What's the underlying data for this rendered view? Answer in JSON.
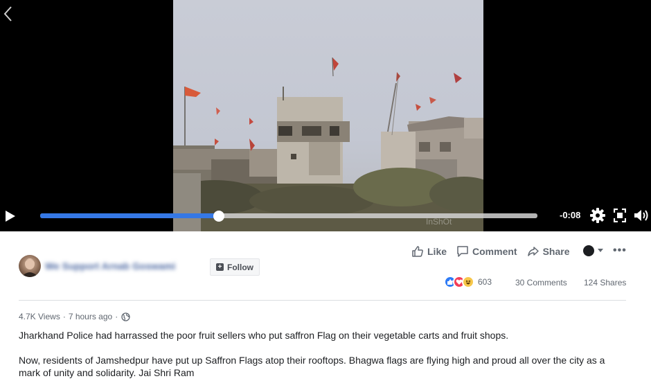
{
  "video": {
    "time_remaining": "-0:08",
    "progress": 0.36,
    "watermark": "InShOt"
  },
  "post": {
    "page_name": "We Support Arnab Goswami",
    "follow_label": "Follow",
    "actions": {
      "like": "Like",
      "comment": "Comment",
      "share": "Share"
    },
    "stats": {
      "reactions": "603",
      "comments": "30 Comments",
      "shares": "124 Shares"
    },
    "meta": {
      "views": "4.7K Views",
      "sep": "·",
      "time": "7 hours ago",
      "sep2": "·"
    },
    "text": {
      "p1": "Jharkhand Police had harrassed the poor fruit sellers who put saffron Flag on their vegetable carts and fruit shops.",
      "p2": "Now, residents of Jamshedpur have put up Saffron Flags atop their rooftops. Bhagwa flags are flying high and proud all over the city as a mark of unity and solidarity. Jai Shri Ram"
    }
  },
  "colors": {
    "progress": "#3578e5",
    "link": "#4b67a1",
    "muted": "#606770"
  },
  "icons": [
    "back-icon",
    "play-icon",
    "gear-icon",
    "fullscreen-icon",
    "volume-icon",
    "like-icon",
    "comment-icon",
    "share-icon",
    "globe-icon"
  ]
}
